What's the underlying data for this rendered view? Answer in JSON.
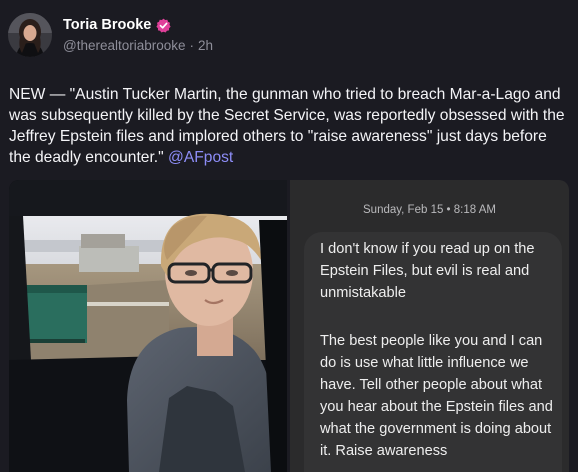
{
  "author": {
    "display_name": "Toria Brooke",
    "handle": "@therealtoriabrooke",
    "time_ago": "2h",
    "separator": "·",
    "verified_icon": "verified-badge-icon",
    "badge_color": "#e0409a"
  },
  "post": {
    "text": "NEW — \"Austin Tucker Martin, the gunman who tried to breach Mar-a-Lago and was subsequently killed by the Secret Service, was reportedly obsessed with the Jeffrey Epstein files and implored others to \"raise awareness\" just days before the deadly encounter.\"",
    "mention": "@AFpost",
    "mention_color": "#8d8df7"
  },
  "media": {
    "screenshot": {
      "timestamp": "Sunday, Feb 15 • 8:18 AM",
      "message_paragraphs": [
        "I don't know if you read up on the Epstein Files, but evil is real and unmistakable",
        "The best people like you and I can do is use what little influence we have. Tell other people about what you hear about the Epstein files and what the government is doing about it. Raise awareness"
      ]
    }
  }
}
